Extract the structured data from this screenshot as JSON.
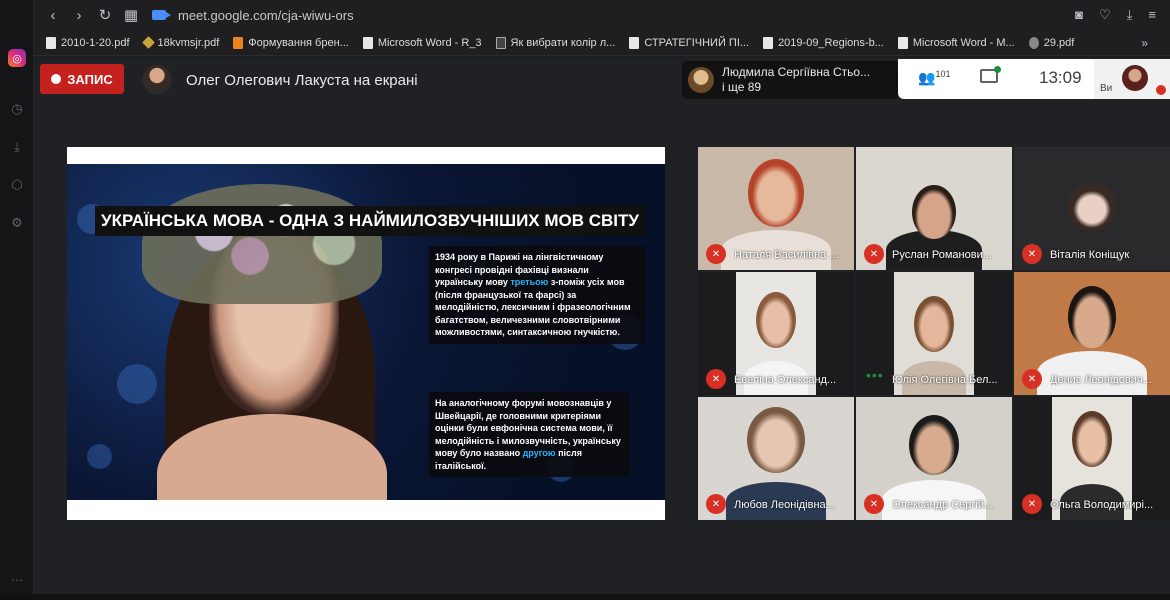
{
  "browser": {
    "url": "meet.google.com/cja-wiwu-ors",
    "bookmarks": [
      {
        "label": "2010-1-20.pdf",
        "icon": "file-icon"
      },
      {
        "label": "18kvmsjr.pdf",
        "icon": "diamond-icon"
      },
      {
        "label": "Формування брен...",
        "icon": "e-icon"
      },
      {
        "label": "Microsoft Word - R_3",
        "icon": "file-icon"
      },
      {
        "label": "Як вибрати колір л...",
        "icon": "a-icon"
      },
      {
        "label": "СТРАТЕГІЧНИЙ ПІ...",
        "icon": "file-icon"
      },
      {
        "label": "2019-09_Regions-b...",
        "icon": "file-icon"
      },
      {
        "label": "Microsoft Word - M...",
        "icon": "file-icon"
      },
      {
        "label": "29.pdf",
        "icon": "globe-icon"
      }
    ]
  },
  "meet": {
    "record_label": "ЗАПИС",
    "presenter_label": "Олег Олегович Лакуста на екрані",
    "speaking_name": "Людмила Сергіївна Стьо...",
    "speaking_more": "і ще 89",
    "participant_count": "101",
    "time": "13:09",
    "self_label": "Ви"
  },
  "slide": {
    "title": "УКРАЇНСЬКА МОВА - ОДНА З НАЙМИЛОЗВУЧНІШИХ МОВ СВІТУ",
    "box1_a": "1934 року в Парижі на лінгвістичному конгресі провідні фахівці визнали українську мову ",
    "box1_hl": "третьою",
    "box1_b": " з-поміж усіх мов (після французької та фарсі) за мелодійністю, лексичним і фразеологічним багатством, величезними словотвірними можливостями, синтаксичною гнучкістю.",
    "box2_a": "На аналогічному форумі мовознавців у Швейцарії, де головними критеріями оцінки були евфонічна система мови, її мелодійність і милозвучність, українську мову було названо ",
    "box2_hl": "другою",
    "box2_b": " після італійської."
  },
  "participants": [
    {
      "name": "Наталя Василівна ...",
      "muted": true
    },
    {
      "name": "Руслан Романови...",
      "muted": true
    },
    {
      "name": "Віталія Коніщук",
      "muted": true
    },
    {
      "name": "Евеліна Олександ...",
      "muted": true
    },
    {
      "name": "Юлія Олегівна Бел...",
      "muted": false
    },
    {
      "name": "Денис Леонідович...",
      "muted": true
    },
    {
      "name": "Любов Леонідівна...",
      "muted": true
    },
    {
      "name": "Олександр Сергій...",
      "muted": true
    },
    {
      "name": "Ольга Володимирі...",
      "muted": true
    }
  ]
}
